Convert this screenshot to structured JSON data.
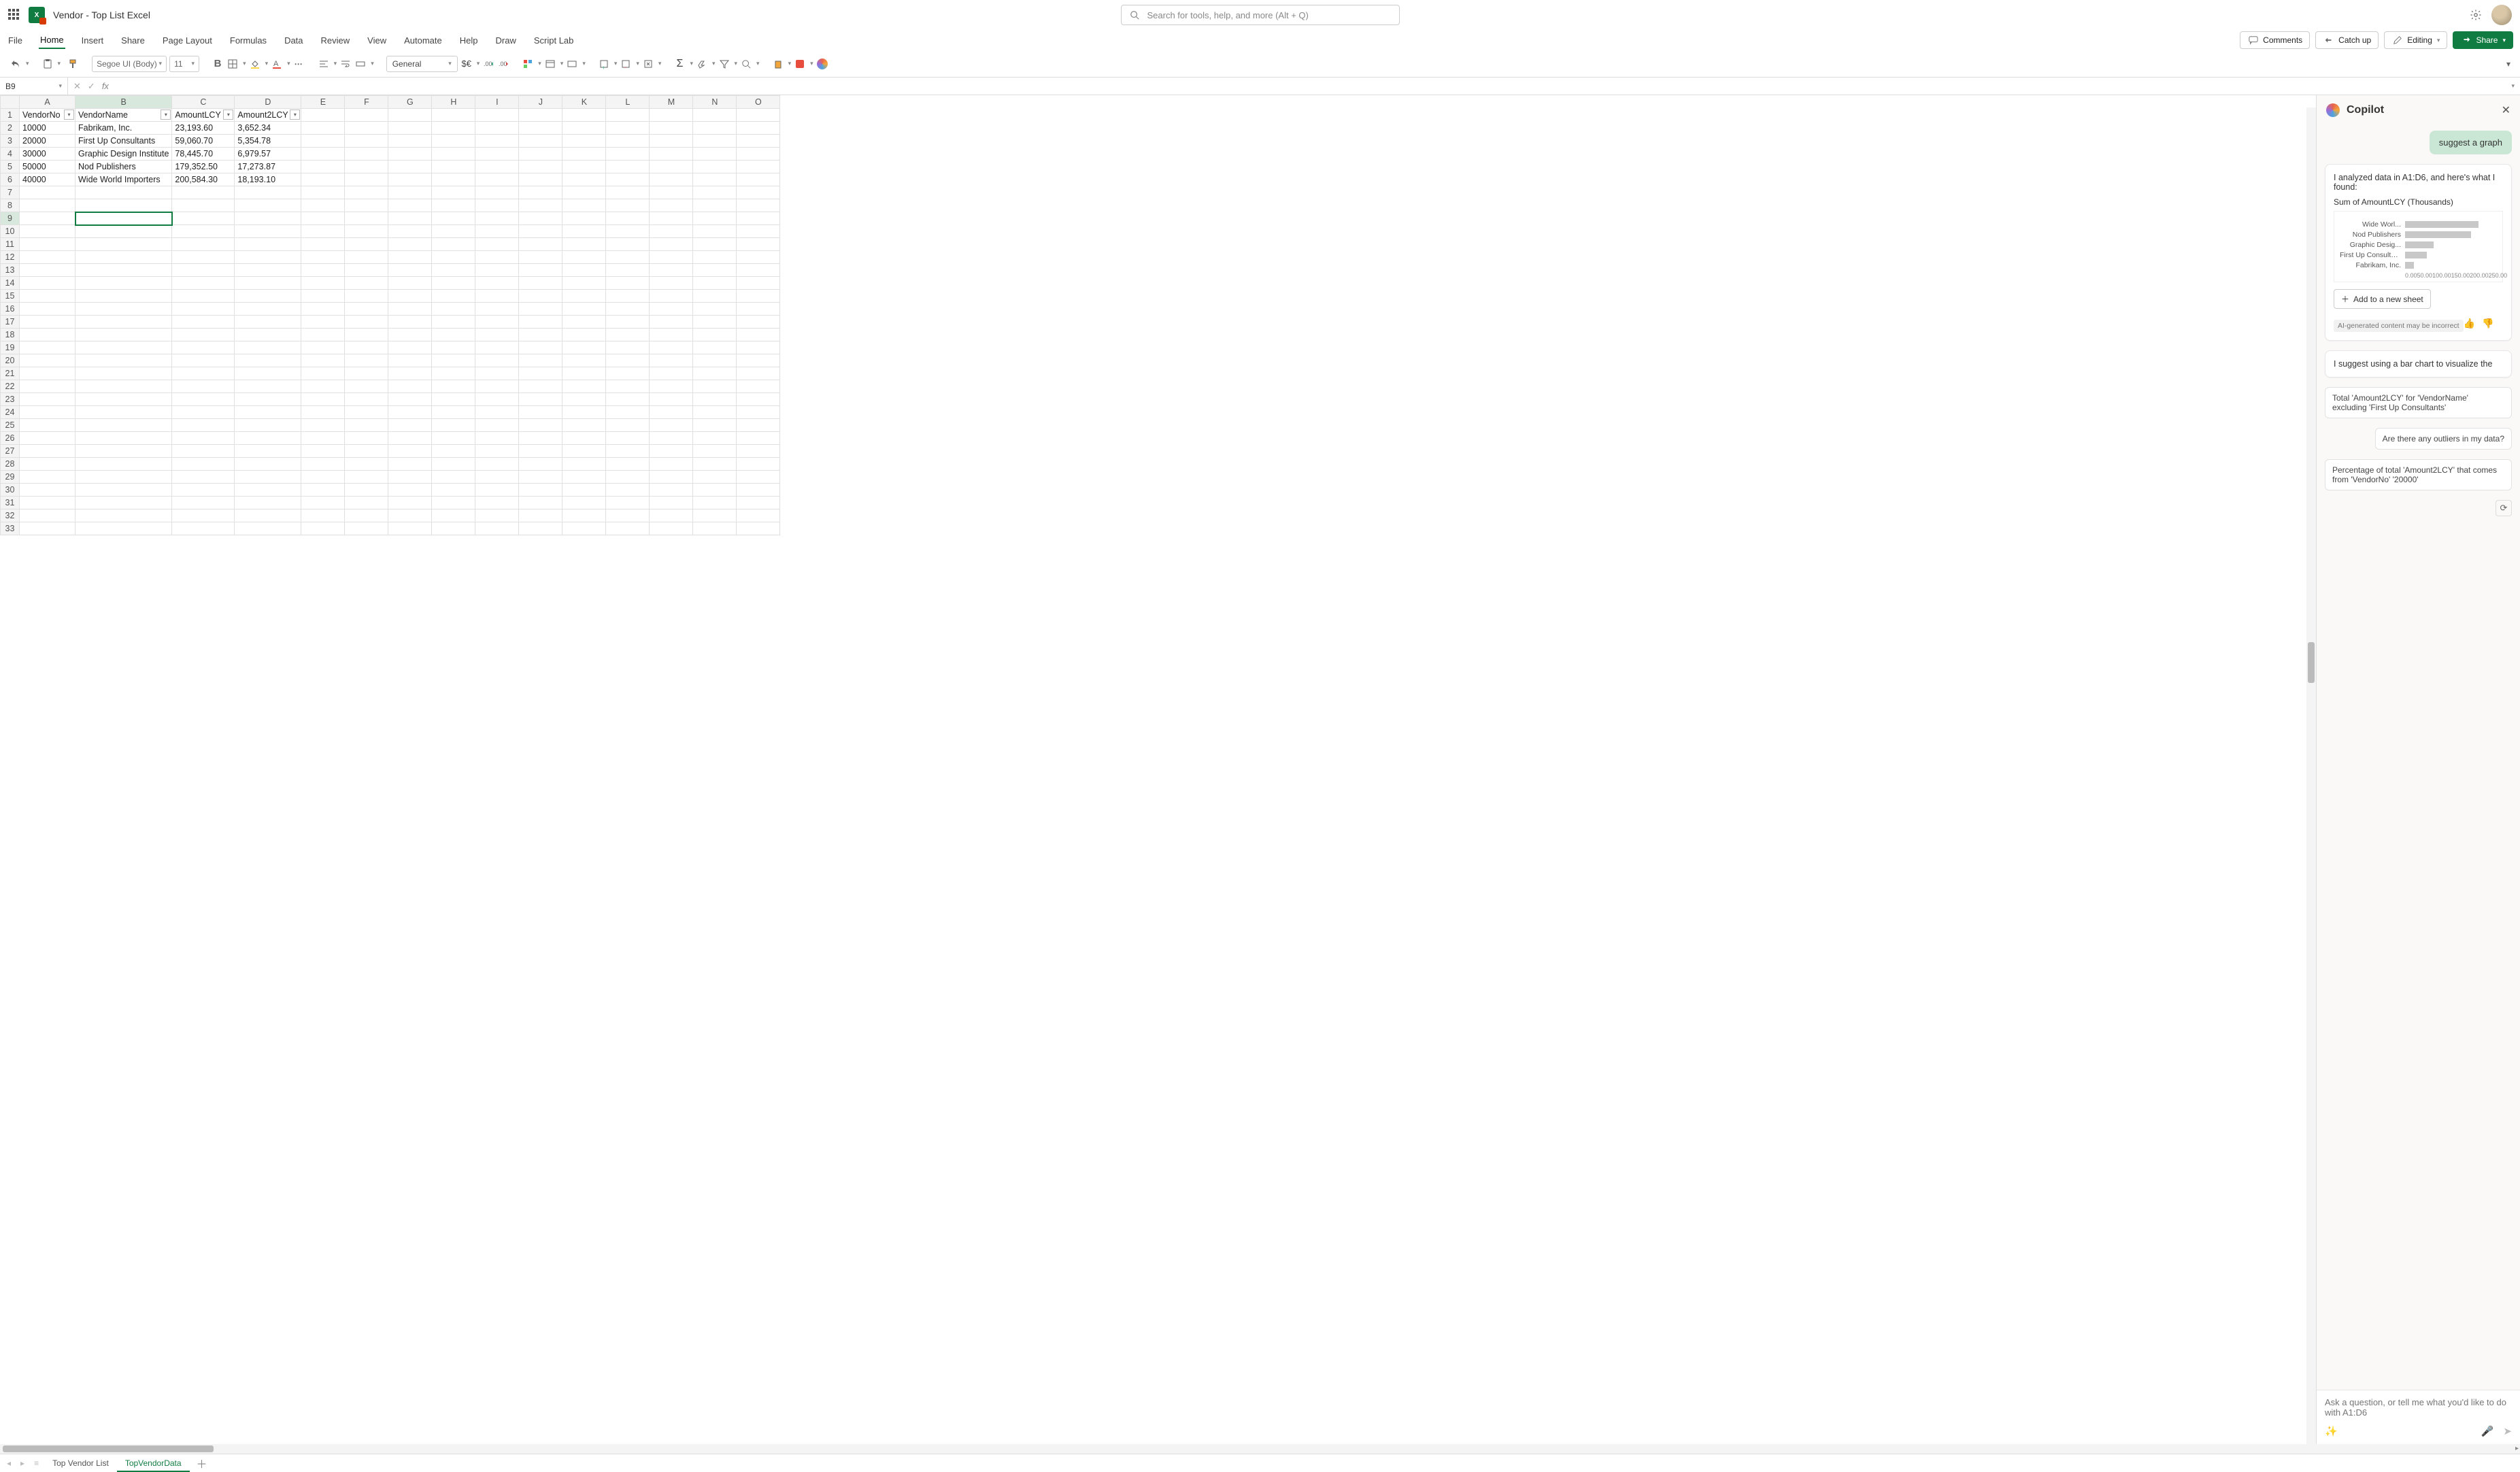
{
  "doc_title": "Vendor - Top List Excel",
  "search_placeholder": "Search for tools, help, and more (Alt + Q)",
  "menu": [
    "File",
    "Home",
    "Insert",
    "Share",
    "Page Layout",
    "Formulas",
    "Data",
    "Review",
    "View",
    "Automate",
    "Help",
    "Draw",
    "Script Lab"
  ],
  "menu_active": "Home",
  "top_actions": {
    "comments": "Comments",
    "catch_up": "Catch up",
    "editing": "Editing",
    "share": "Share"
  },
  "ribbon": {
    "font_name": "Segoe UI (Body)",
    "font_size": "11",
    "number_format": "General"
  },
  "name_box": "B9",
  "columns": [
    "A",
    "B",
    "C",
    "D",
    "E",
    "F",
    "G",
    "H",
    "I",
    "J",
    "K",
    "L",
    "M",
    "N",
    "O"
  ],
  "headers": [
    "VendorNo",
    "VendorName",
    "AmountLCY",
    "Amount2LCY"
  ],
  "rows": [
    {
      "n": "10000",
      "name": "Fabrikam, Inc.",
      "a": "23,193.60",
      "b": "3,652.34"
    },
    {
      "n": "20000",
      "name": "First Up Consultants",
      "a": "59,060.70",
      "b": "5,354.78"
    },
    {
      "n": "30000",
      "name": "Graphic Design Institute",
      "a": "78,445.70",
      "b": "6,979.57"
    },
    {
      "n": "50000",
      "name": "Nod Publishers",
      "a": "179,352.50",
      "b": "17,273.87"
    },
    {
      "n": "40000",
      "name": "Wide World Importers",
      "a": "200,584.30",
      "b": "18,193.10"
    }
  ],
  "total_rows": 33,
  "selected_cell": {
    "row": 9,
    "col": "B"
  },
  "sheet_tabs": [
    "Top Vendor List",
    "TopVendorData"
  ],
  "active_tab": "TopVendorData",
  "copilot": {
    "title": "Copilot",
    "user_prompt": "suggest a graph",
    "analysis_line": "I analyzed data in A1:D6, and here's what I found:",
    "chart_title": "Sum of AmountLCY (Thousands)",
    "add_sheet": "Add to a new sheet",
    "disclaimer": "AI-generated content may be incorrect",
    "followup": "I suggest using a bar chart to visualize the",
    "suggestions": [
      "Total 'Amount2LCY' for 'VendorName' excluding 'First Up Consultants'",
      "Are there any outliers in my data?",
      "Percentage of total 'Amount2LCY' that comes from 'VendorNo' '20000'"
    ],
    "input_placeholder": "Ask a question, or tell me what you'd like to do with A1:D6"
  },
  "chart_data": {
    "type": "bar",
    "orientation": "horizontal",
    "title": "Sum of AmountLCY (Thousands)",
    "categories": [
      "Wide Worl...",
      "Nod Publishers",
      "Graphic Desig...",
      "First Up Consultants",
      "Fabrikam, Inc."
    ],
    "values": [
      200.58,
      179.35,
      78.45,
      59.06,
      23.19
    ],
    "xlabel": "",
    "ylabel": "",
    "xlim": [
      0,
      250
    ],
    "ticks": [
      "0.00",
      "50.00",
      "100.00",
      "150.00",
      "200.00",
      "250.00"
    ]
  }
}
